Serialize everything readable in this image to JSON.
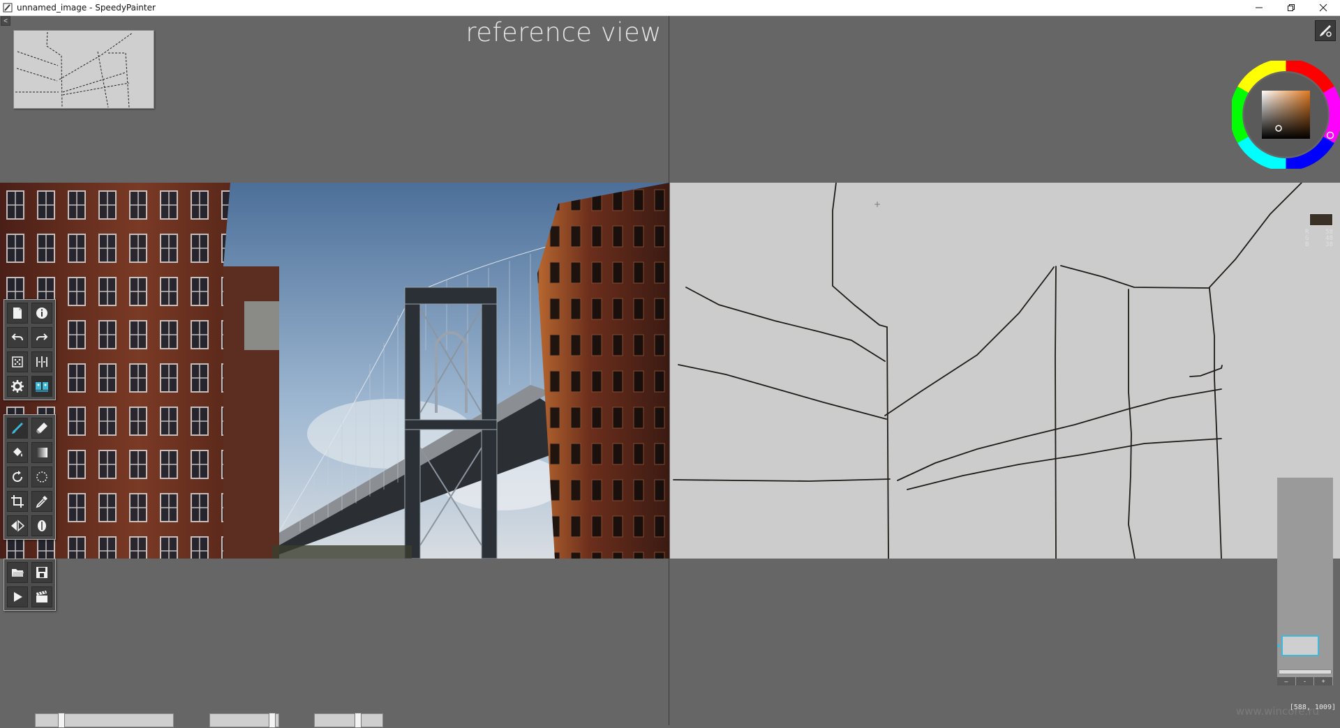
{
  "window": {
    "title": "unnamed_image - SpeedyPainter",
    "minimize": "–",
    "restore": "❐",
    "close": "✕"
  },
  "left_pane": {
    "collapse_label": "<",
    "reference_title": "reference view"
  },
  "toolbox_top": [
    {
      "name": "new-image-icon"
    },
    {
      "name": "info-icon"
    },
    {
      "name": "undo-icon"
    },
    {
      "name": "redo-icon"
    },
    {
      "name": "random-icon"
    },
    {
      "name": "mirror-icon"
    },
    {
      "name": "gear-icon"
    },
    {
      "name": "reference-view-icon"
    }
  ],
  "toolbox_mid": [
    {
      "name": "brush-icon"
    },
    {
      "name": "eraser-icon"
    },
    {
      "name": "fill-icon"
    },
    {
      "name": "gradient-icon"
    },
    {
      "name": "rotate-icon"
    },
    {
      "name": "lasso-icon"
    },
    {
      "name": "crop-icon"
    },
    {
      "name": "eyedropper-icon"
    },
    {
      "name": "flip-icon"
    },
    {
      "name": "mask-icon"
    }
  ],
  "toolbox_bottom": [
    {
      "name": "open-folder-icon"
    },
    {
      "name": "save-icon"
    },
    {
      "name": "play-icon"
    },
    {
      "name": "clapper-icon"
    }
  ],
  "sliders": [
    {
      "name": "brush-size-slider",
      "value": 0.17
    },
    {
      "name": "opacity-slider",
      "value": 0.95
    },
    {
      "name": "smoothing-slider",
      "value": 0.65
    }
  ],
  "color": {
    "current_hex": "#3a3026",
    "r_label": "R",
    "r_value": "58",
    "g_label": "G",
    "g_value": "48",
    "b_label": "B",
    "b_value": "38"
  },
  "layers": {
    "minus_label": "–",
    "dash_label": "-",
    "plus_label": "+"
  },
  "status": {
    "coords": "[588, 1009]",
    "watermark": "www.wincore.ru"
  }
}
